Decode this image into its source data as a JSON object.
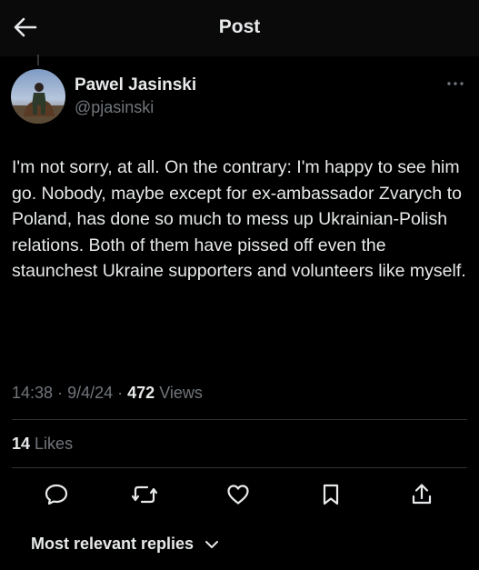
{
  "header": {
    "title": "Post",
    "back_icon": "arrow-left-icon"
  },
  "post": {
    "author": {
      "name": "Pawel Jasinski",
      "handle": "@pjasinski",
      "avatar": "avatar-photo"
    },
    "text": "I'm not sorry, at all. On the contrary: I'm happy to see him go. Nobody, maybe except for ex-ambassador Zvarych to Poland, has done so much to mess up Ukrainian-Polish relations. Both of them have pissed off even the staunchest Ukraine supporters and volunteers like myself.",
    "time": "14:38",
    "date": "9/4/24",
    "separator": "·",
    "views_count": "472",
    "views_label": "Views",
    "likes_count": "14",
    "likes_label": "Likes"
  },
  "actions": [
    {
      "name": "reply",
      "icon": "speech-bubble-icon"
    },
    {
      "name": "repost",
      "icon": "repost-arrows-icon"
    },
    {
      "name": "like",
      "icon": "heart-icon"
    },
    {
      "name": "bookmark",
      "icon": "bookmark-icon"
    },
    {
      "name": "share",
      "icon": "share-upload-icon"
    }
  ],
  "replies": {
    "sort_label": "Most relevant replies"
  },
  "colors": {
    "background": "#000000",
    "text_primary": "#e7e9ea",
    "text_secondary": "#71767b",
    "divider": "#2f3336"
  }
}
